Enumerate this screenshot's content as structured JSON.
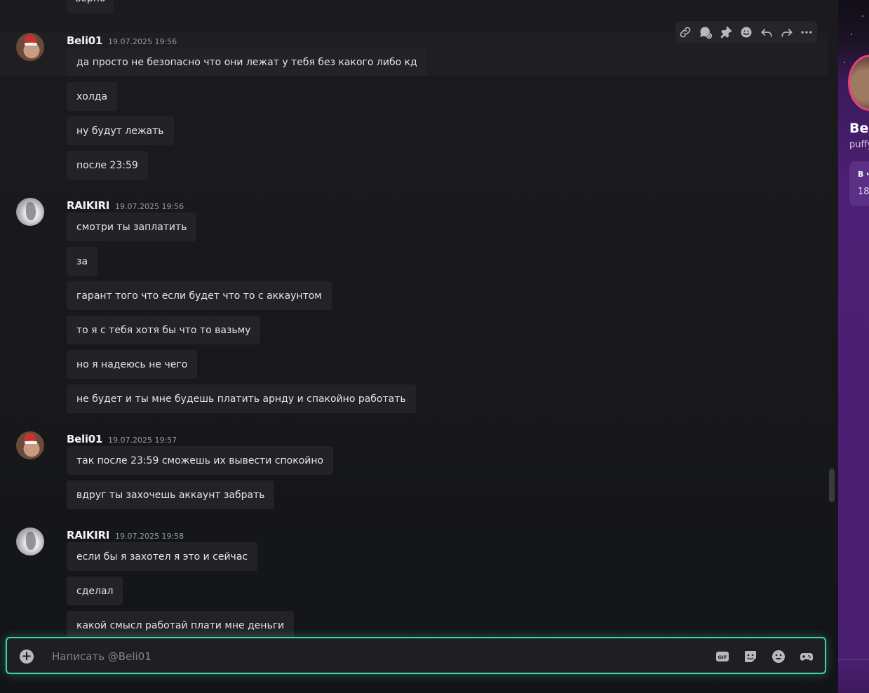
{
  "chat": {
    "top_cut_text": "верно",
    "toolbar_icons": [
      "link-icon",
      "thread-icon",
      "pin-icon",
      "emoji-icon",
      "reply-icon",
      "forward-icon",
      "more-icon"
    ],
    "groups": [
      {
        "author": "Beli01",
        "timestamp": "19.07.2025 19:56",
        "avatar": "beli",
        "messages": [
          "да просто не безопасно что они лежат у тебя без какого либо кд",
          "холда",
          "ну будут лежать",
          "после 23:59"
        ]
      },
      {
        "author": "RAIKIRI",
        "timestamp": "19.07.2025 19:56",
        "avatar": "raikiri",
        "messages": [
          "смотри ты заплатить",
          "за",
          "гарант того что если будет что то с аккаунтом",
          "то я с тебя хотя бы что то вазьму",
          "но я надеюсь не чего",
          "не будет и ты мне будешь платить арнду и спакойно работать"
        ]
      },
      {
        "author": "Beli01",
        "timestamp": "19.07.2025 19:57",
        "avatar": "beli",
        "messages": [
          "так после 23:59 сможешь их вывести спокойно",
          "вдруг ты захочешь аккаунт забрать"
        ]
      },
      {
        "author": "RAIKIRI",
        "timestamp": "19.07.2025 19:58",
        "avatar": "raikiri",
        "messages": [
          "если бы я захотел я это и сейчас",
          "сделал",
          "какой смысл работай плати мне деньги"
        ]
      }
    ]
  },
  "composer": {
    "placeholder": "Написать @Beli01",
    "icons": [
      "add-attachment-icon",
      "gif-icon",
      "sticker-icon",
      "emoji-icon",
      "apps-icon"
    ],
    "accent": "#3fd99b"
  },
  "sidebar": {
    "name_partial": "Bel",
    "subtitle_partial": "puffy",
    "card_title_partial": "В ч",
    "card_value_partial": "18",
    "accent": "#e8407c"
  },
  "colors": {
    "background": "#18181b",
    "bubble": "#232327",
    "sidebar": "#4c1f74"
  }
}
